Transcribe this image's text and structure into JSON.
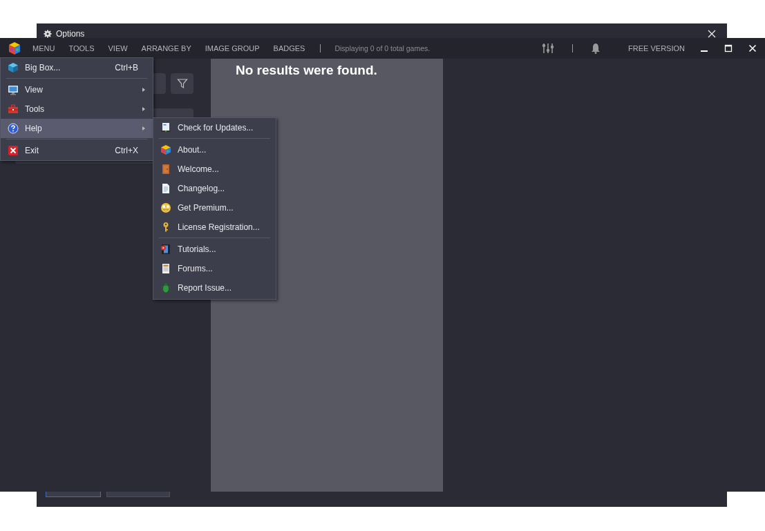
{
  "options_window": {
    "title": "Options"
  },
  "toolbar": {
    "menus": [
      {
        "label": "MENU"
      },
      {
        "label": "TOOLS"
      },
      {
        "label": "VIEW"
      },
      {
        "label": "ARRANGE BY"
      },
      {
        "label": "IMAGE GROUP"
      },
      {
        "label": "BADGES"
      }
    ],
    "status": "Displaying 0 of 0 total games.",
    "version": "FREE VERSION"
  },
  "results": {
    "message": "No results were found."
  },
  "main_menu": {
    "items": [
      {
        "kind": "item",
        "label": "Big Box...",
        "shortcut": "Ctrl+B",
        "submenu": false,
        "selected": false
      },
      {
        "kind": "separator"
      },
      {
        "kind": "item",
        "label": "View",
        "submenu": true,
        "selected": false
      },
      {
        "kind": "item",
        "label": "Tools",
        "submenu": true,
        "selected": false
      },
      {
        "kind": "item",
        "label": "Help",
        "submenu": true,
        "selected": true
      },
      {
        "kind": "separator"
      },
      {
        "kind": "item",
        "label": "Exit",
        "shortcut": "Ctrl+X",
        "submenu": false,
        "selected": false
      }
    ]
  },
  "help_submenu": {
    "items": [
      {
        "kind": "item",
        "label": "Check for Updates..."
      },
      {
        "kind": "separator"
      },
      {
        "kind": "item",
        "label": "About..."
      },
      {
        "kind": "item",
        "label": "Welcome..."
      },
      {
        "kind": "item",
        "label": "Changelog..."
      },
      {
        "kind": "item",
        "label": "Get Premium..."
      },
      {
        "kind": "item",
        "label": "License Registration..."
      },
      {
        "kind": "separator"
      },
      {
        "kind": "item",
        "label": "Tutorials..."
      },
      {
        "kind": "item",
        "label": "Forums..."
      },
      {
        "kind": "item",
        "label": "Report Issue..."
      }
    ]
  }
}
